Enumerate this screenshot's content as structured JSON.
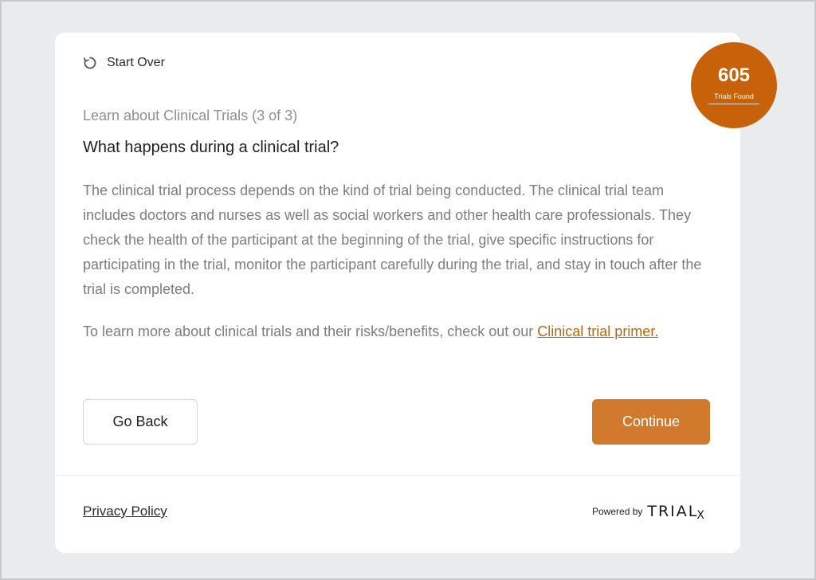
{
  "nav": {
    "start_over_label": "Start Over"
  },
  "badge": {
    "count": "605",
    "label": "Trials Found",
    "color": "#c8620a"
  },
  "content": {
    "step_label": "Learn about Clinical Trials (3 of 3)",
    "heading": "What happens during a clinical trial?",
    "paragraph1": "The clinical trial process depends on the kind of trial being conducted. The clinical trial team includes doctors and nurses as well as social workers and other health care professionals. They check the health of the participant at the beginning of the trial, give specific instructions for participating in the trial, monitor the participant carefully during the trial, and stay in touch after the trial is completed.",
    "paragraph2_text": "To learn more about clinical trials and their risks/benefits, check out our ",
    "paragraph2_link": "Clinical trial primer."
  },
  "buttons": {
    "back_label": "Go Back",
    "continue_label": "Continue",
    "continue_color": "#d17a2e"
  },
  "footer": {
    "privacy_label": "Privacy Policy",
    "powered_by_label": "Powered by",
    "brand_logo_text": "TRIAL",
    "brand_logo_suffix": "X"
  },
  "icons": {
    "start_over": "refresh-icon"
  }
}
